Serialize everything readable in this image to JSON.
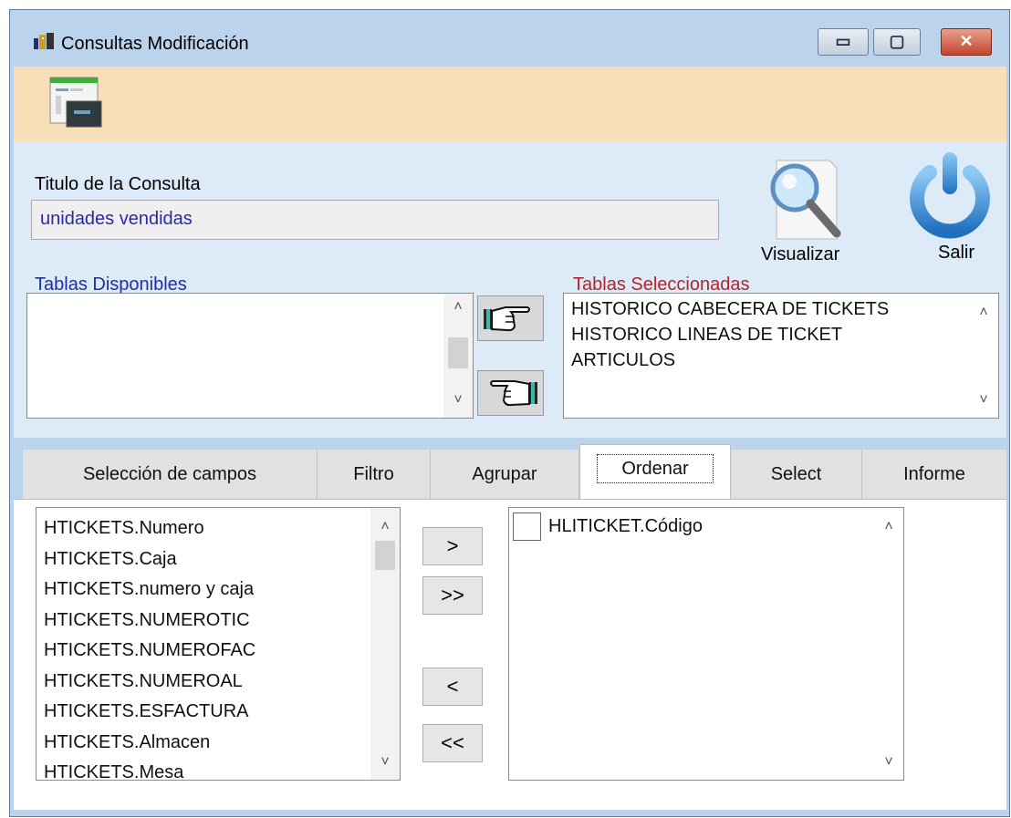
{
  "window": {
    "title": "Consultas Modificación",
    "controls": {
      "minimize": "▭",
      "maximize": "▢",
      "close": "✕"
    }
  },
  "toolbar": {
    "icon": "query-design-icon"
  },
  "form": {
    "title_label": "Titulo de la Consulta",
    "title_value": "unidades vendidas",
    "visualizar_label": "Visualizar",
    "salir_label": "Salir",
    "available_label": "Tablas Disponibles",
    "selected_label": "Tablas Seleccionadas",
    "available_tables": [],
    "selected_tables": [
      "HISTORICO CABECERA DE TICKETS",
      "HISTORICO LINEAS DE TICKET",
      "ARTICULOS"
    ]
  },
  "tabs": [
    {
      "label": "Selección de campos"
    },
    {
      "label": "Filtro"
    },
    {
      "label": "Agrupar"
    },
    {
      "label": "Ordenar",
      "active": true
    },
    {
      "label": "Select"
    },
    {
      "label": "Informe"
    }
  ],
  "ordenar": {
    "fields": [
      "HTICKETS.Numero",
      "HTICKETS.Caja",
      "HTICKETS.numero y caja",
      "HTICKETS.NUMEROTIC",
      "HTICKETS.NUMEROFAC",
      "HTICKETS.NUMEROAL",
      "HTICKETS.ESFACTURA",
      "HTICKETS.Almacen",
      "HTICKETS.Mesa"
    ],
    "buttons": {
      "add": ">",
      "add_all": ">>",
      "remove": "<",
      "remove_all": "<<"
    },
    "order_fields": [
      {
        "label": "HLITICKET.Código",
        "checked": false
      }
    ]
  },
  "scroll": {
    "up": "˄",
    "down": "˅"
  },
  "colors": {
    "title_input_text": "#2a2aa2",
    "available_label": "#1c2fa8",
    "selected_label": "#b2242a",
    "toolbar_bg": "#f8dfb8"
  }
}
